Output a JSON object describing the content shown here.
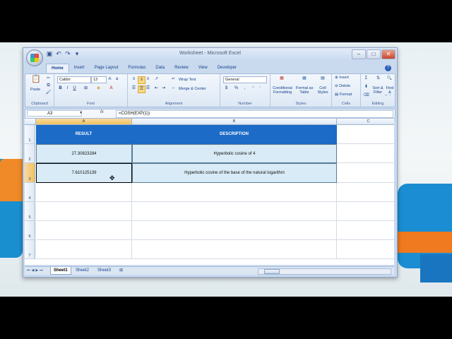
{
  "window": {
    "title": "Worksheet - Microsoft Excel"
  },
  "ribbon_tabs": [
    "Home",
    "Insert",
    "Page Layout",
    "Formulas",
    "Data",
    "Review",
    "View",
    "Developer"
  ],
  "ribbon": {
    "clipboard": {
      "label": "Clipboard",
      "paste": "Paste"
    },
    "font": {
      "label": "Font",
      "name": "Calibri",
      "size": "13",
      "bold": "B",
      "italic": "I",
      "underline": "U"
    },
    "alignment": {
      "label": "Alignment",
      "wrap_text": "Wrap Text",
      "merge_center": "Merge & Center"
    },
    "number": {
      "label": "Number",
      "format": "General",
      "currency": "$",
      "percent": "%",
      "comma": ","
    },
    "styles": {
      "label": "Styles",
      "conditional": "Conditional Formatting",
      "format_table": "Format as Table",
      "cell_styles": "Cell Styles"
    },
    "cells": {
      "label": "Cells",
      "insert": "Insert",
      "delete": "Delete",
      "format": "Format"
    },
    "editing": {
      "label": "Editing",
      "sum": "Σ",
      "sort": "Sort & Filter",
      "find": "Find & Select"
    }
  },
  "formula_bar": {
    "name_box": "A3",
    "fx": "fx",
    "formula": "=COSH(EXP(1))"
  },
  "columns": [
    "A",
    "B",
    "C"
  ],
  "rows": [
    "1",
    "2",
    "3",
    "4",
    "5",
    "6",
    "7"
  ],
  "table": {
    "headers": [
      "RESULT",
      "DESCRIPTION"
    ],
    "rows": [
      [
        "27.30823284",
        "Hyperbolic cosine of 4"
      ],
      [
        "7.610125139",
        "Hyperbolic cosine of the base of the natural logarithm"
      ]
    ]
  },
  "sheets": [
    "Sheet1",
    "Sheet2",
    "Sheet3"
  ],
  "active_sheet": "Sheet1",
  "colors": {
    "header_fill": "#1c6bc7",
    "data_fill": "#d8ebf6"
  }
}
